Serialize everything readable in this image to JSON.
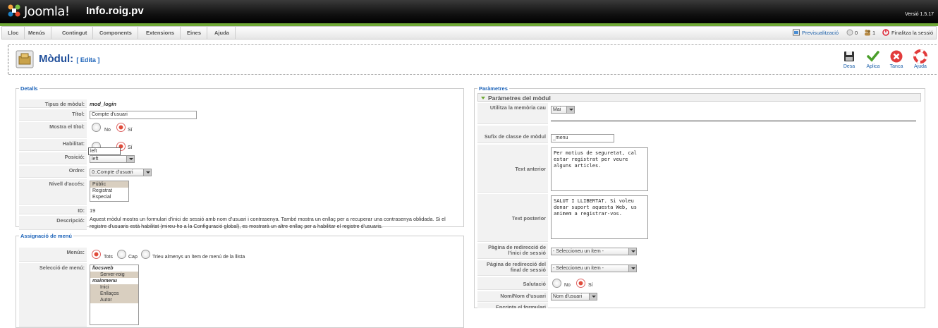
{
  "header": {
    "logo": "Joomla!",
    "site": "Info.roig.pv",
    "version": "Versió 1.5.17"
  },
  "menu": [
    "Lloc",
    "Menús",
    "Contingut",
    "Components",
    "Extensions",
    "Eines",
    "Ajuda"
  ],
  "status": {
    "preview": "Previsualització",
    "messages": "0",
    "users": "1",
    "logout": "Finalitza la sessió"
  },
  "title": {
    "main": "Mòdul:",
    "sub": "[ Edita ]"
  },
  "toolbar": {
    "save": "Desa",
    "apply": "Aplica",
    "close": "Tanca",
    "help": "Ajuda"
  },
  "details": {
    "legend": "Detalls",
    "type_label": "Tipus de mòdul:",
    "type_value": "mod_login",
    "title_label": "Títol:",
    "title_value": "Compte d'usuari",
    "show_title_label": "Mostra el títol:",
    "no": "No",
    "yes": "Sí",
    "enabled_label": "Habilitat:",
    "tooltip": "left",
    "position_label": "Posició:",
    "position_value": "left",
    "order_label": "Ordre:",
    "order_value": "0::Compte d'usuari",
    "access_label": "Nivell d'accés:",
    "access_options": [
      "Públic",
      "Registrat",
      "Especial"
    ],
    "id_label": "ID:",
    "id_value": "19",
    "desc_label": "Descripció:",
    "desc_value": "Aquest mòdul mostra un formulari d'inici de sessió amb nom d'usuari i contrasenya. També mostra un enllaç per a recuperar una contrasenya oblidada. Si el registre d'usuaris està habilitat (mireu-ho a la Configuració global), es mostrarà un altre enllaç per a habilitar el registre d'usuaris."
  },
  "assign": {
    "legend": "Assignació de menú",
    "menus_label": "Menús:",
    "all": "Tots",
    "none": "Cap",
    "choose": "Trieu almenys un ítem de menú de la llista",
    "select_label": "Selecció de menú:",
    "items": [
      {
        "t": "llocsweb",
        "h": true
      },
      {
        "t": "Server-roig",
        "h": false
      },
      {
        "t": "mainmenu",
        "h": true
      },
      {
        "t": "Inici",
        "h": false
      },
      {
        "t": "Enllaços",
        "h": false
      },
      {
        "t": "Autor",
        "h": false
      }
    ]
  },
  "params": {
    "legend": "Paràmetres",
    "section": "Paràmetres del mòdul",
    "cache_label": "Utilitza la memòria cau",
    "cache_value": "Mai",
    "suffix_label": "Sufix de classe de mòdul",
    "suffix_value": "_menu",
    "pre_label": "Text anterior",
    "pre_value": "Per motius de seguretat, cal estar registrat per veure alguns articles.",
    "post_label": "Text posterior",
    "post_value": "SALUT I LLIBERTAT. Si voleu donar suport aquesta Web, us animem a registrar-vos.",
    "login_redir_label": "Pàgina de redirecció de l'inici de sessió",
    "login_redir_value": "- Seleccioneu un ítem -",
    "logout_redir_label": "Pàgina de redirecció del final de sessió",
    "logout_redir_value": "- Seleccioneu un ítem -",
    "greeting_label": "Salutació",
    "no": "No",
    "yes": "Sí",
    "name_label": "Nom/Nom d'usuari",
    "name_value": "Nom d'usuari",
    "encrypt_label": "Encripta el formulari"
  }
}
